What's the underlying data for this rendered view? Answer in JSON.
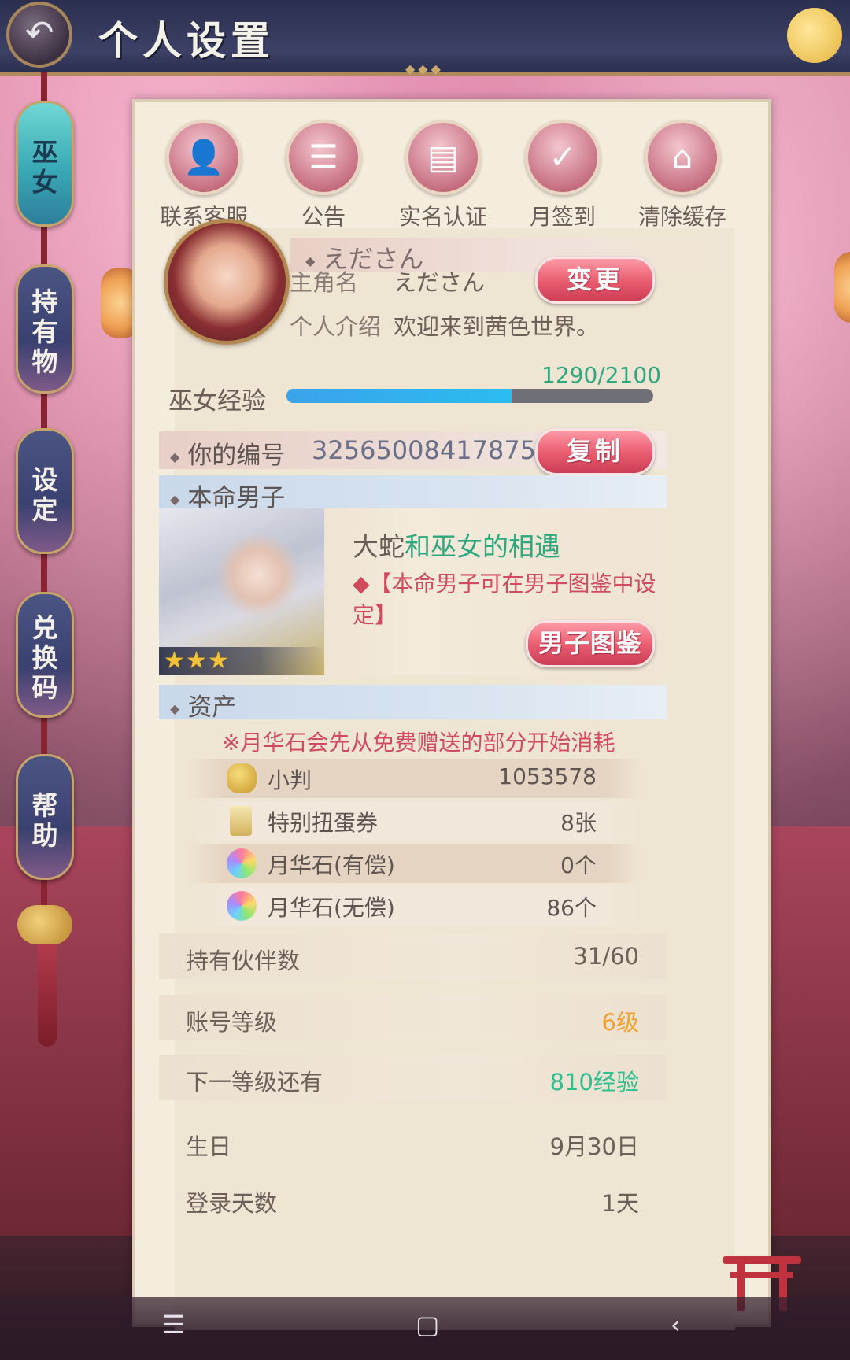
{
  "header": {
    "title": "个人设置"
  },
  "sidebar": {
    "tabs": [
      {
        "label": [
          "巫",
          "女"
        ],
        "active": true
      },
      {
        "label": [
          "持",
          "有",
          "物"
        ],
        "active": false
      },
      {
        "label": [
          "设",
          "定"
        ],
        "active": false
      },
      {
        "label": [
          "兑",
          "换",
          "码"
        ],
        "active": false
      },
      {
        "label": [
          "帮",
          "助"
        ],
        "active": false
      }
    ]
  },
  "shortcuts": [
    {
      "label": "联系客服",
      "icon": "customer-service-icon"
    },
    {
      "label": "公告",
      "icon": "notice-icon"
    },
    {
      "label": "实名认证",
      "icon": "id-verify-icon"
    },
    {
      "label": "月签到",
      "icon": "calendar-check-icon"
    },
    {
      "label": "清除缓存",
      "icon": "broom-icon"
    }
  ],
  "profile": {
    "display_name": "えださん",
    "name_label": "主角名",
    "name_value": "えださん",
    "change_button": "变更",
    "intro_label": "个人介绍",
    "intro_value": "欢迎来到茜色世界。",
    "exp_label": "巫女经验",
    "exp_text": "1290/2100",
    "exp_current": 1290,
    "exp_max": 2100
  },
  "id_section": {
    "label": "你的编号",
    "number": "325650084178754",
    "copy_button": "复制"
  },
  "partner": {
    "section_title": "本命男子",
    "name": "大蛇",
    "name_suffix": "和巫女的相遇",
    "hint": "◆【本命男子可在男子图鉴中设定】",
    "rarity_stars": 3,
    "book_button": "男子图鉴"
  },
  "assets": {
    "section_title": "资产",
    "note": "※月华石会先从免费赠送的部分开始消耗",
    "items": [
      {
        "name": "小判",
        "value": "1053578",
        "icon": "gold-coin-icon"
      },
      {
        "name": "特别扭蛋券",
        "value": "8张",
        "icon": "gacha-ticket-icon"
      },
      {
        "name": "月华石(有偿)",
        "value": "0个",
        "icon": "moon-gem-icon"
      },
      {
        "name": "月华石(无偿)",
        "value": "86个",
        "icon": "moon-gem-icon"
      }
    ]
  },
  "stats": [
    {
      "label": "持有伙伴数",
      "value": "31/60",
      "color": "#6d5f5a"
    },
    {
      "label": "账号等级",
      "value": "6级",
      "color": "#f0a030"
    },
    {
      "label": "下一等级还有",
      "value": "810经验",
      "color": "#2fbf90"
    },
    {
      "label": "生日",
      "value": "9月30日",
      "color": "#6d5f5a"
    },
    {
      "label": "登录天数",
      "value": "1天",
      "color": "#6d5f5a"
    }
  ]
}
